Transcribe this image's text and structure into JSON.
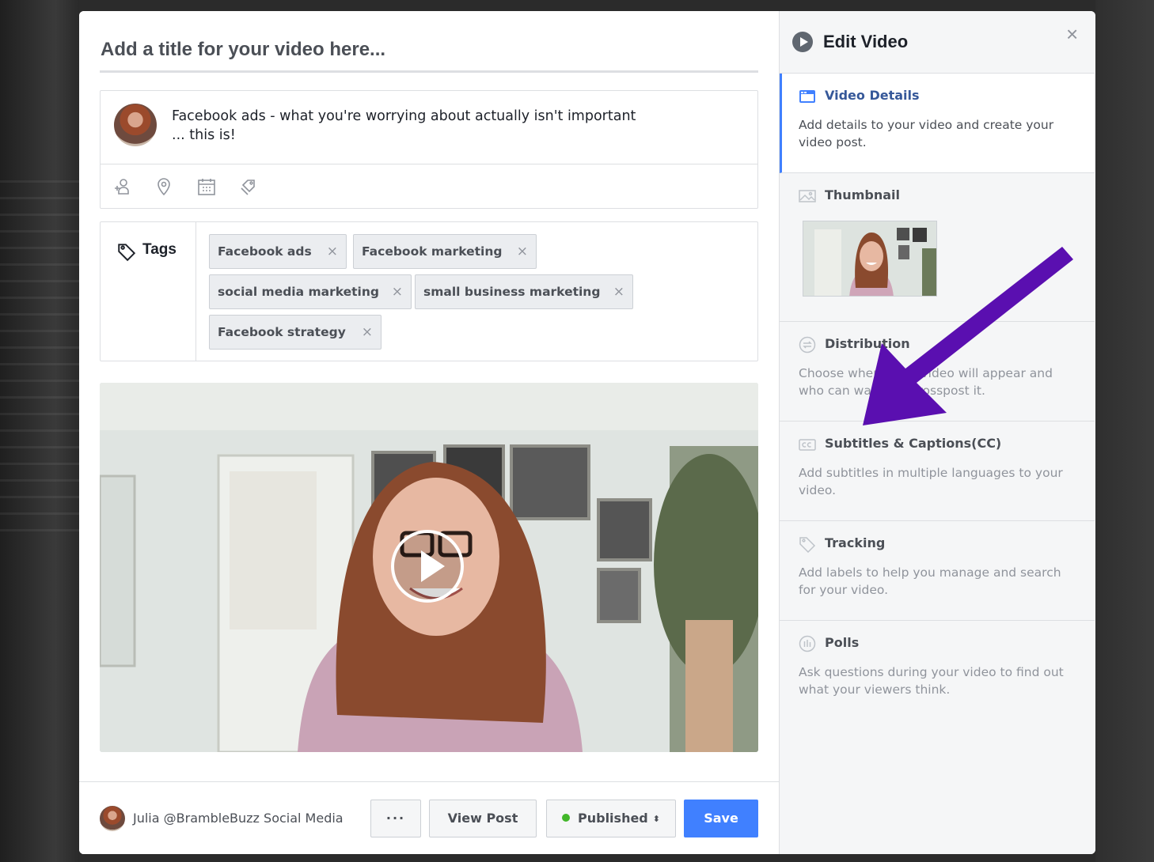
{
  "editor": {
    "title_placeholder": "Add a title for your video here...",
    "description": "Facebook ads - what you're worrying about actually isn't important\n... this is!",
    "toolbar": [
      {
        "icon": "tag-people-icon"
      },
      {
        "icon": "location-pin-icon"
      },
      {
        "icon": "calendar-icon"
      },
      {
        "icon": "feeling-icon"
      }
    ]
  },
  "tags": {
    "label": "Tags",
    "items": [
      "Facebook ads",
      "Facebook marketing",
      "social media marketing",
      "small business marketing",
      "Facebook strategy"
    ],
    "remove_glyph": "×"
  },
  "player": {
    "play_icon": "play-icon"
  },
  "footer": {
    "page_name": "Julia @BrambleBuzz Social Media",
    "more_label": "···",
    "view_post_label": "View Post",
    "publish_label": "Published",
    "publish_caret": "⬍",
    "save_label": "Save",
    "colors": {
      "accent": "#4080ff",
      "published_dot": "#42b72a"
    }
  },
  "sidebar": {
    "title": "Edit Video",
    "close_glyph": "×",
    "sections": [
      {
        "title": "Video Details",
        "desc": "Add details to your video and create your video post.",
        "icon": "video-details-icon",
        "active": true
      },
      {
        "title": "Thumbnail",
        "desc": "",
        "icon": "image-icon",
        "active": false
      },
      {
        "title": "Distribution",
        "desc": "Choose where your video will appear and who can watch or crosspost it.",
        "icon": "distribution-icon",
        "active": false
      },
      {
        "title": "Subtitles & Captions(CC)",
        "desc": "Add subtitles in multiple languages to your video.",
        "icon": "cc-icon",
        "active": false
      },
      {
        "title": "Tracking",
        "desc": "Add labels to help you manage and search for your video.",
        "icon": "tag-icon",
        "active": false
      },
      {
        "title": "Polls",
        "desc": "Ask questions during your video to find out what your viewers think.",
        "icon": "polls-icon",
        "active": false
      }
    ]
  },
  "annotation": {
    "arrow_color": "#5a0fb0",
    "icon": "purple-arrow-icon"
  }
}
